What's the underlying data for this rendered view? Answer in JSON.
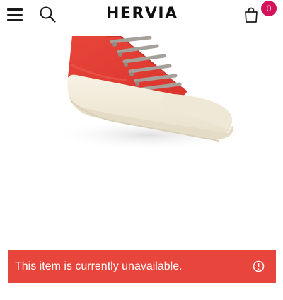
{
  "header": {
    "logo": "HERVIA",
    "cart_count": "0",
    "icons": [
      "menu-icon",
      "search-icon",
      "shopping-bag-icon"
    ]
  },
  "product": {
    "image": "red-high-top-sneaker"
  },
  "alert": {
    "message": "This item is currently unavailable.",
    "icon": "info-alert-icon"
  },
  "colors": {
    "badge": "#d4145a",
    "alert_background": "#e8463c",
    "shoe_upper": "#e23c33",
    "shoe_sole": "#f2ecdc"
  }
}
